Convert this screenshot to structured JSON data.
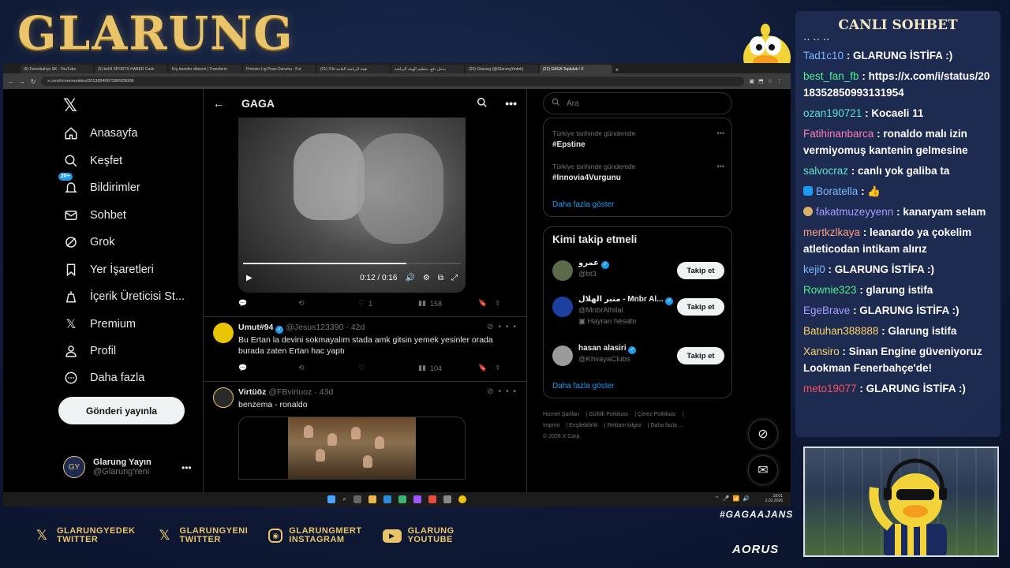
{
  "overlay": {
    "logo": "GLARUNG",
    "hashtag": "#GAGAAJANS",
    "sponsor": "AORUS",
    "socials": [
      {
        "line1": "GLARUNGYEDEK",
        "line2": "TWITTER",
        "icon": "x-icon"
      },
      {
        "line1": "GLARUNGYENI",
        "line2": "TWITTER",
        "icon": "x-icon"
      },
      {
        "line1": "GLARUNGMERT",
        "line2": "INSTAGRAM",
        "icon": "instagram-icon"
      },
      {
        "line1": "GLARUNG",
        "line2": "YOUTUBE",
        "icon": "youtube-icon"
      }
    ],
    "gaga_badge": "gaga",
    "accent": "#e9c46a"
  },
  "chat": {
    "title": "CANLI SOHBET",
    "messages": [
      {
        "user": "Tad1c10",
        "color": "#7ab8ff",
        "text": ": GLARUNG İSTİFA :)"
      },
      {
        "user": "best_fan_fb",
        "color": "#4cf08a",
        "text": ": https://x.com/i/status/2018352850993131954"
      },
      {
        "user": "ozan190721",
        "color": "#5fe3d0",
        "text": ": Kocaeli 11"
      },
      {
        "user": "Fatihinanbarca",
        "color": "#ff7eb3",
        "text": ": ronaldo malı izin vermiyomuş kantenin gelmesine"
      },
      {
        "user": "salvocraz",
        "color": "#5fe3d0",
        "text": ": canlı yok galiba ta"
      },
      {
        "user": "Boratella",
        "color": "#7ab8ff",
        "text": ": 👍"
      },
      {
        "user": "fakatmuzeyyenn",
        "color": "#a89bff",
        "text": ": kanaryam selam"
      },
      {
        "user": "mertkzlkaya",
        "color": "#ff9b7a",
        "text": ": leanardo ya çokelim atleticodan intikam alırız"
      },
      {
        "user": "keji0",
        "color": "#7ab8ff",
        "text": ": GLARUNG İSTİFA :)"
      },
      {
        "user": "Rownie323",
        "color": "#4cf08a",
        "text": ": glarung istifa"
      },
      {
        "user": "EgeBrave",
        "color": "#a89bff",
        "text": ": GLARUNG İSTİFA :)"
      },
      {
        "user": "Batuhan388888",
        "color": "#ffd36a",
        "text": ": Glarung istifa"
      },
      {
        "user": "Xansiro",
        "color": "#ffd36a",
        "text": ": Sinan Engine güveniyoruz Lookman Fenerbahçe'de!"
      },
      {
        "user": "meto19077",
        "color": "#ff4d5a",
        "text": ": GLARUNG İSTİFA :)"
      }
    ]
  },
  "browser": {
    "tabs": [
      "(5) Fenerbahçe SK - YouTube",
      "(5) beIN SPORTS HABER Canlı",
      "Kış transfer dönemi | Transferm",
      "Premier Lig Puan Durumu - Fut",
      "(21) X'te هيئة الرياضة العامة",
      "يدخل دفع. بتنظيم الهيئة الرياضة",
      "(20) Glarung (@GlarungYedek)",
      "(21) GAGA Topluluk / X"
    ],
    "url": "x.com/i/communities/2013894067280929008"
  },
  "x": {
    "nav": [
      {
        "label": "Anasayfa",
        "icon": "home-icon"
      },
      {
        "label": "Keşfet",
        "icon": "search-icon"
      },
      {
        "label": "Bildirimler",
        "icon": "bell-icon",
        "badge": "20+"
      },
      {
        "label": "Sohbet",
        "icon": "mail-icon"
      },
      {
        "label": "Grok",
        "icon": "grok-icon"
      },
      {
        "label": "Yer İşaretleri",
        "icon": "bookmark-icon"
      },
      {
        "label": "İçerik Üreticisi St...",
        "icon": "creator-icon"
      },
      {
        "label": "Premium",
        "icon": "x-icon"
      },
      {
        "label": "Profil",
        "icon": "profile-icon"
      },
      {
        "label": "Daha fazla",
        "icon": "more-icon"
      }
    ],
    "post_button": "Gönderi yayınla",
    "account": {
      "name": "Glarung Yayın",
      "handle": "@GlarungYeni",
      "avatar": "GY"
    },
    "main": {
      "title": "GAGA",
      "video": {
        "time": "0:12 / 0:16",
        "progress": 0.75
      },
      "video_stats": {
        "likes": "1",
        "views": "158"
      },
      "tweets": [
        {
          "name": "Umut#94",
          "handle": "@Jesus123390",
          "time": "42d",
          "text": "Bu Ertan la devini sokmayalım stada amk gitsin yemek yesinler orada burada zaten Ertan hac yaptı",
          "views": "104",
          "verified": true
        },
        {
          "name": "Virtüöz",
          "handle": "@FBvirtuoz",
          "time": "43d",
          "text": "benzema - ronaldo",
          "verified": false
        }
      ]
    },
    "search_placeholder": "Ara",
    "trends": [
      {
        "meta": "Türkiye tarihinde gündemde",
        "name": "#Epstine"
      },
      {
        "meta": "Türkiye tarihinde gündemde",
        "name": "#Innovia4Vurgunu"
      }
    ],
    "trends_more": "Daha fazla göster",
    "follow_title": "Kimi takip etmeli",
    "follow": [
      {
        "name": "عمرو",
        "handle": "@bt3",
        "extra": "",
        "button": "Takip et"
      },
      {
        "name": "منبر الهلال - Mnbr Al...",
        "handle": "@MnbrAlhilal",
        "extra": "Hayran hesabı",
        "button": "Takip et"
      },
      {
        "name": "hasan alasiri",
        "handle": "@KhvayaClubs",
        "extra": "",
        "button": "Takip et"
      }
    ],
    "follow_more": "Daha fazla göster",
    "footer": [
      "Hizmet Şartları",
      "Gizlilik Politikası",
      "Çerez Politikası",
      "Imprint",
      "Erişilebilirlik",
      "Reklam bilgisi",
      "Daha fazla ...",
      "© 2026 X Corp."
    ]
  },
  "taskbar": {
    "time": "18:01",
    "date": "2.02.2026"
  }
}
